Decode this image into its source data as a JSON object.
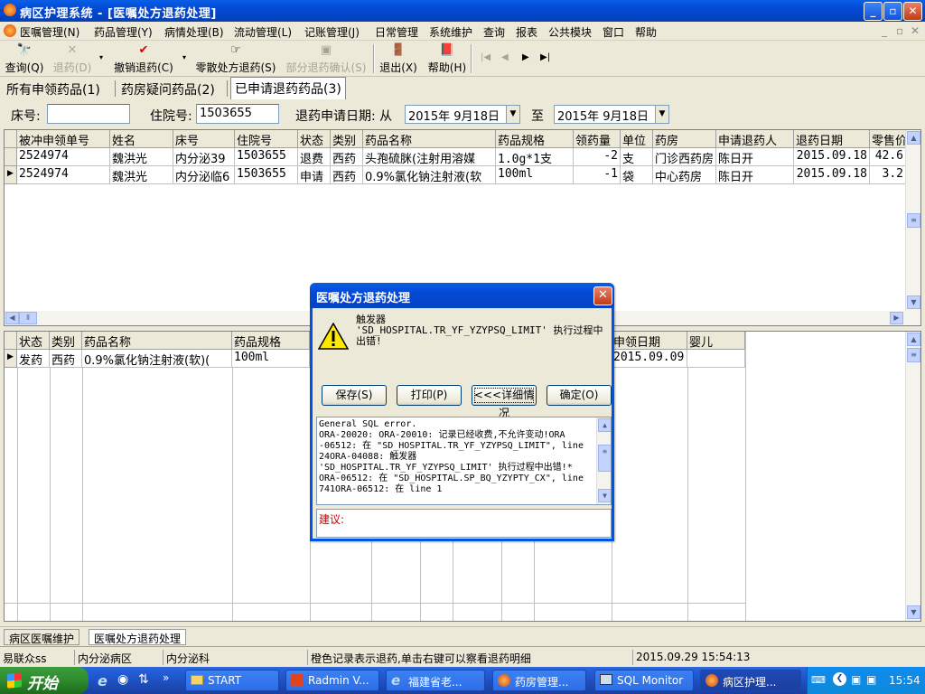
{
  "window": {
    "title": "病区护理系统 - [医嘱处方退药处理]",
    "min": "_",
    "max": "▫",
    "close": "✕"
  },
  "menu": {
    "items": [
      "医嘱管理(N)",
      "药品管理(Y)",
      "病情处理(B)",
      "流动管理(L)",
      "记账管理(J)",
      "日常管理",
      "系统维护",
      "查询",
      "报表",
      "公共模块",
      "窗口",
      "帮助"
    ],
    "mdi_controls": [
      "_",
      "▫",
      "✕"
    ]
  },
  "toolbar": {
    "query": "查询(Q)",
    "refund": "退药(D)",
    "cancel_refund": "撤销退药(C)",
    "retail_refund": "零散处方退药(S)",
    "partial_confirm": "部分退药确认(S)",
    "exit": "退出(X)",
    "help": "帮助(H)",
    "nav": [
      "|◀",
      "◀",
      "▶",
      "▶|"
    ]
  },
  "tabs": [
    "所有申领药品(1)",
    "药房疑问药品(2)",
    "已申请退药药品(3)"
  ],
  "filter": {
    "bed_label": "床号:",
    "bed_value": "",
    "inpatient_label": "住院号:",
    "inpatient_value": "1503655",
    "date_label": "退药申请日期: 从",
    "date_from": "2015年 9月18日",
    "to_label": "至",
    "date_to": "2015年 9月18日"
  },
  "top_grid": {
    "headers": [
      "被冲申领单号",
      "姓名",
      "床号",
      "住院号",
      "状态",
      "类别",
      "药品名称",
      "药品规格",
      "领药量",
      "单位",
      "药房",
      "申请退药人",
      "退药日期",
      "零售价"
    ],
    "rows": [
      [
        "2524974",
        "魏洪光",
        "内分泌39",
        "1503655",
        "退费",
        "西药",
        "头孢硫脒(注射用溶媒",
        "1.0g*1支",
        "-2",
        "支",
        "门诊西药房",
        "陈日开",
        "2015.09.18",
        "42.6"
      ],
      [
        "2524974",
        "魏洪光",
        "内分泌临6",
        "1503655",
        "申请",
        "西药",
        "0.9%氯化钠注射液(软",
        "100ml",
        "-1",
        "袋",
        "中心药房",
        "陈日开",
        "2015.09.18",
        "3.2"
      ]
    ]
  },
  "bottom_grid": {
    "headers": [
      "状态",
      "类别",
      "药品名称",
      "药品规格",
      "申领日期",
      "婴儿"
    ],
    "rows": [
      [
        "发药",
        "西药",
        "0.9%氯化钠注射液(软)(",
        "100ml",
        "2015.09.09",
        ""
      ]
    ]
  },
  "dialog": {
    "title": "医嘱处方退药处理",
    "message": "触发器\n'SD_HOSPITAL.TR_YF_YZYPSQ_LIMIT' 执行过程中出错!",
    "buttons": {
      "save": "保存(S)",
      "print": "打印(P)",
      "detail": "<<<详细情况",
      "ok": "确定(O)"
    },
    "detail_lines": [
      "General SQL error.",
      "ORA-20020: ORA-20010: 记录已经收费,不允许变动!ORA",
      "-06512: 在 \"SD_HOSPITAL.TR_YF_YZYPSQ_LIMIT\", line",
      "24ORA-04088: 触发器",
      "'SD_HOSPITAL.TR_YF_YZYPSQ_LIMIT' 执行过程中出错!*",
      "ORA-06512: 在 \"SD_HOSPITAL.SP_BQ_YZYPTY_CX\", line",
      "741ORA-06512: 在 line 1"
    ],
    "suggest_label": "建议:"
  },
  "mdi_tabs": [
    "病区医嘱维护",
    "医嘱处方退药处理"
  ],
  "status": {
    "user": "易联众ss",
    "ward": "内分泌病区",
    "dept": "内分泌科",
    "hint": "橙色记录表示退药,单击右键可以察看退药明细",
    "datetime": "2015.09.29 15:54:13"
  },
  "taskbar": {
    "start": "开始",
    "tasks": [
      "START",
      "Radmin V...",
      "福建省老...",
      "药房管理...",
      "SQL Monitor",
      "病区护理..."
    ],
    "clock": "15:54"
  }
}
